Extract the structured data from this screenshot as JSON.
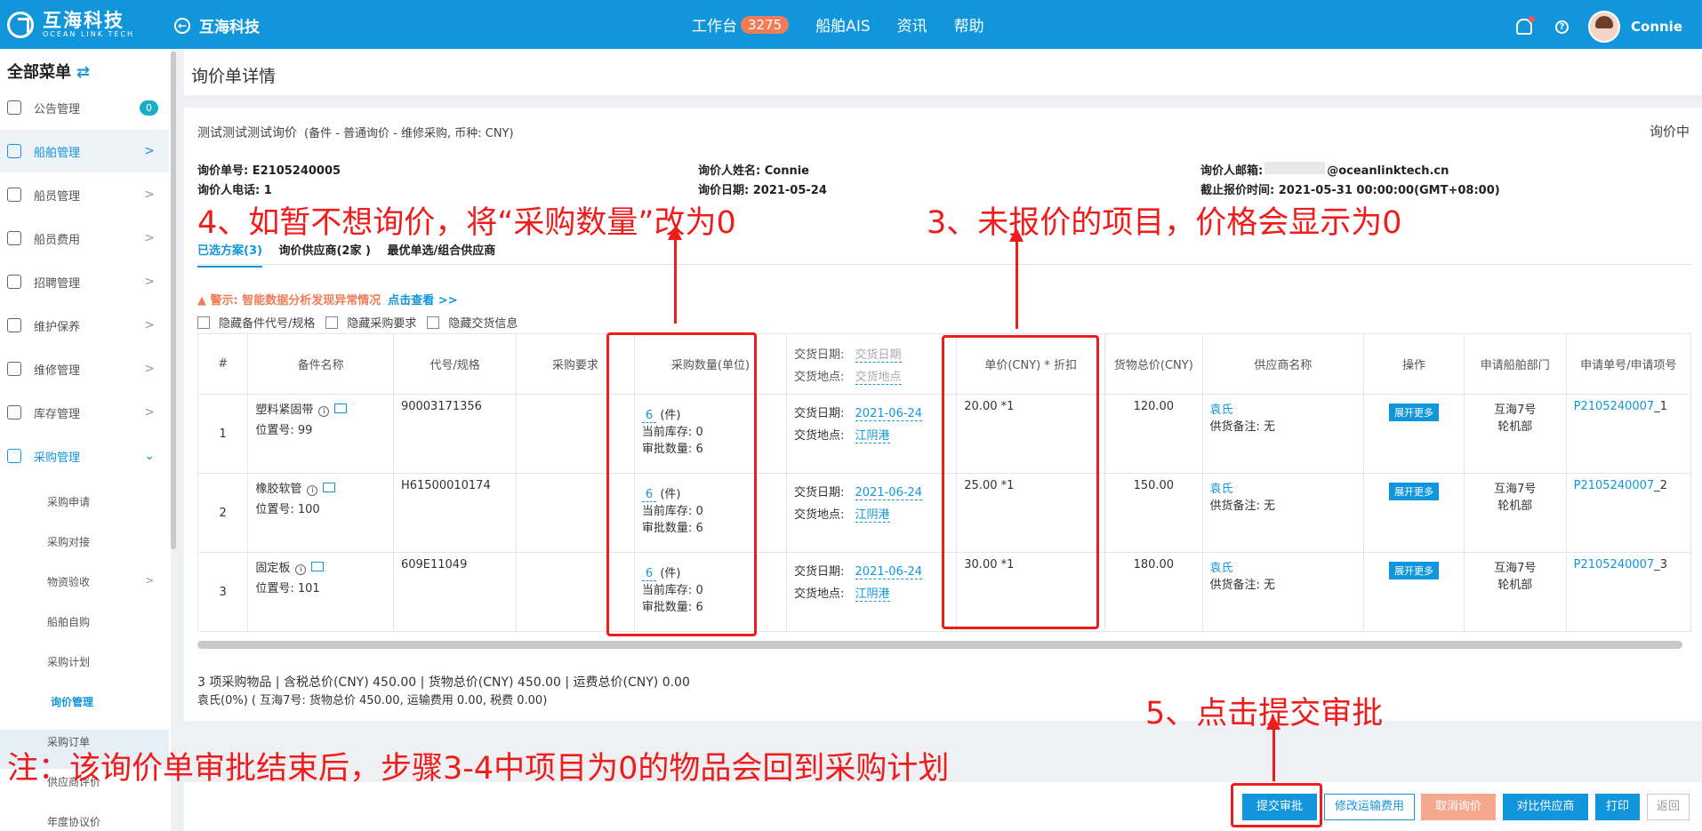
{
  "topbar": {
    "logo_cn": "互海科技",
    "logo_en": "OCEAN LINK TECH",
    "back_label": "互海科技",
    "nav": [
      {
        "label": "工作台",
        "badge": "3275"
      },
      {
        "label": "船舶AIS"
      },
      {
        "label": "资讯"
      },
      {
        "label": "帮助"
      }
    ],
    "user": "Connie"
  },
  "sidebar": {
    "title": "全部菜单",
    "items": [
      {
        "label": "公告管理",
        "count": "0"
      },
      {
        "label": "船舶管理"
      },
      {
        "label": "船员管理"
      },
      {
        "label": "船员费用"
      },
      {
        "label": "招聘管理"
      },
      {
        "label": "维护保养"
      },
      {
        "label": "维修管理"
      },
      {
        "label": "库存管理"
      },
      {
        "label": "采购管理"
      }
    ],
    "subitems": [
      "采购申请",
      "采购对接",
      "物资验收",
      "船舶自购",
      "采购计划",
      "询价管理",
      "采购订单",
      "供应商评价",
      "年度协议价"
    ]
  },
  "page": {
    "title": "询价单详情"
  },
  "inquiry": {
    "name": "测试测试测试询价",
    "meta": "(备件 - 普通询价 - 维修采购, 币种: CNY)",
    "status": "询价中",
    "no": "询价单号: E2105240005",
    "inquirer_phone": "询价人电话: 1",
    "inquirer_name": "询价人姓名: Connie",
    "inquiry_date": "询价日期: 2021-05-24",
    "inquirer_email_label": "询价人邮箱:",
    "inquirer_email": "@oceanlinktech.cn",
    "deadline": "截止报价时间: 2021-05-31 00:00:00(GMT+08:00)"
  },
  "tabs": [
    "已选方案(3)",
    "询价供应商(2家 )",
    "最优单选/组合供应商"
  ],
  "warning": {
    "text": "警示: 智能数据分析发现异常情况",
    "link": "点击查看 >>"
  },
  "checks": [
    "隐藏备件代号/规格",
    "隐藏采购要求",
    "隐藏交货信息"
  ],
  "table": {
    "headers": {
      "no": "#",
      "name": "备件名称",
      "code": "代号/规格",
      "req": "采购要求",
      "qty": "采购数量(单位)",
      "del_date": "交货日期:",
      "del_place": "交货地点:",
      "del_date_ph": "交货日期",
      "del_place_ph": "交货地点",
      "price": "单价(CNY) * 折扣",
      "total": "货物总价(CNY)",
      "supplier": "供应商名称",
      "op": "操作",
      "dept": "申请船舶部门",
      "app": "申请单号/申请项号"
    },
    "labels": {
      "pos": "位置号: ",
      "unit": "(件)",
      "stock": "当前库存: ",
      "approve": "审批数量: ",
      "date_label": "交货日期:",
      "place_label": "交货地点:",
      "remark": "供货备注: 无",
      "expand": "展开更多"
    },
    "rows": [
      {
        "no": "1",
        "name": "塑料紧固带",
        "pos": "99",
        "code": "90003171356",
        "qty": "6",
        "stock": "0",
        "approve": "6",
        "date": "2021-06-24",
        "place": "江阴港",
        "price": "20.00 *1",
        "total": "120.00",
        "supplier": "袁氏",
        "dept1": "互海7号",
        "dept2": "轮机部",
        "app_no": "P2105240007",
        "app_item": "_1"
      },
      {
        "no": "2",
        "name": "橡胶软管",
        "pos": "100",
        "code": "H61500010174",
        "qty": "6",
        "stock": "0",
        "approve": "6",
        "date": "2021-06-24",
        "place": "江阴港",
        "price": "25.00 *1",
        "total": "150.00",
        "supplier": "袁氏",
        "dept1": "互海7号",
        "dept2": "轮机部",
        "app_no": "P2105240007",
        "app_item": "_2"
      },
      {
        "no": "3",
        "name": "固定板",
        "pos": "101",
        "code": "609E11049",
        "qty": "6",
        "stock": "0",
        "approve": "6",
        "date": "2021-06-24",
        "place": "江阴港",
        "price": "30.00 *1",
        "total": "180.00",
        "supplier": "袁氏",
        "dept1": "互海7号",
        "dept2": "轮机部",
        "app_no": "P2105240007",
        "app_item": "_3"
      }
    ]
  },
  "summary": {
    "line1": "3 项采购物品   |   含税总价(CNY)  450.00   |   货物总价(CNY)  450.00   |   运费总价(CNY)  0.00",
    "line2": "袁氏(0%) ( 互海7号: 货物总价  450.00, 运输费用  0.00, 税费  0.00)"
  },
  "buttons": [
    "提交审批",
    "修改运输费用",
    "取消询价",
    "对比供应商",
    "打印",
    "返回"
  ],
  "annotations": {
    "a4": "4、如暂不想询价，将“采购数量”改为0",
    "a3": "3、未报价的项目，价格会显示为0",
    "a5": "5、点击提交审批",
    "note": "注：该询价单审批结束后，步骤3-4中项目为0的物品会回到采购计划"
  },
  "colors": {
    "primary": "#1296db",
    "warning": "#ef7d57",
    "annotation": "#ef1c1c"
  }
}
